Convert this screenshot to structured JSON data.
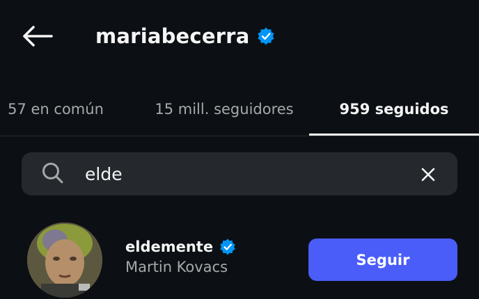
{
  "colors": {
    "background": "#0c1014",
    "primary_text": "#f5f5f5",
    "secondary_text": "#a8a8a8",
    "verified_badge": "#0095f6",
    "search_background": "#25292e",
    "follow_button": "#4a5df9"
  },
  "header": {
    "back_icon": "arrow-left-icon",
    "title": "mariabecerra",
    "verified_icon": "verified-badge-icon"
  },
  "tabs": [
    {
      "label": "57 en común",
      "active": false
    },
    {
      "label": "15 mill. seguidores",
      "active": false
    },
    {
      "label": "959 seguidos",
      "active": true
    }
  ],
  "search": {
    "icon": "search-icon",
    "value": "elde",
    "clear_icon": "close-icon"
  },
  "results": [
    {
      "username": "eldemente",
      "verified": true,
      "full_name": "Martin Kovacs",
      "button_label": "Seguir"
    }
  ]
}
